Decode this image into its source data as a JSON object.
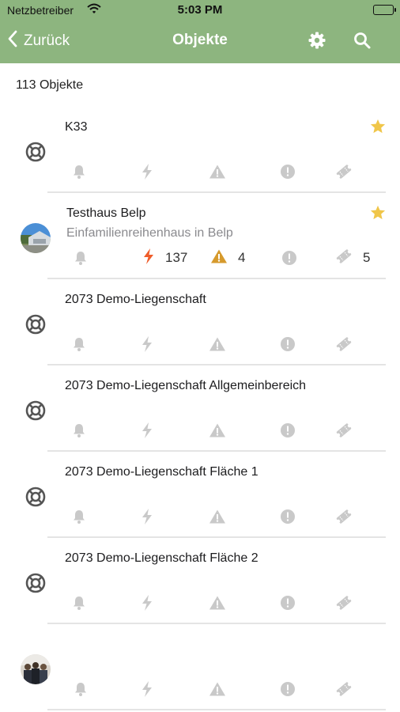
{
  "status_bar": {
    "carrier": "Netzbetreiber",
    "time": "5:03 PM"
  },
  "nav": {
    "back_label": "Zurück",
    "title": "Objekte"
  },
  "summary": {
    "count_text": "113 Objekte"
  },
  "colors": {
    "header_green": "#8db57f",
    "icon_gray": "#c9c9c9",
    "star_yellow": "#f0c64a",
    "bolt_orange": "#ef5d2a",
    "warning_amber": "#d69a2d"
  },
  "objects": [
    {
      "name": "K33",
      "subtitle": "",
      "leading": "lifebuoy-icon",
      "favorite": true,
      "stats": {
        "alarms": "",
        "faults": "",
        "warnings": "",
        "infos": "",
        "tickets": ""
      }
    },
    {
      "name": "Testhaus Belp",
      "subtitle": "Einfamilienreihenhaus in Belp",
      "leading": "house-photo-avatar",
      "favorite": true,
      "stats": {
        "alarms": "",
        "faults": "137",
        "warnings": "4",
        "infos": "",
        "tickets": "5"
      }
    },
    {
      "name": "2073 Demo-Liegenschaft",
      "subtitle": "",
      "leading": "lifebuoy-icon",
      "favorite": false,
      "stats": {
        "alarms": "",
        "faults": "",
        "warnings": "",
        "infos": "",
        "tickets": ""
      }
    },
    {
      "name": "2073 Demo-Liegenschaft Allgemeinbereich",
      "subtitle": "",
      "leading": "lifebuoy-icon",
      "favorite": false,
      "stats": {
        "alarms": "",
        "faults": "",
        "warnings": "",
        "infos": "",
        "tickets": ""
      }
    },
    {
      "name": "2073 Demo-Liegenschaft Fläche 1",
      "subtitle": "",
      "leading": "lifebuoy-icon",
      "favorite": false,
      "stats": {
        "alarms": "",
        "faults": "",
        "warnings": "",
        "infos": "",
        "tickets": ""
      }
    },
    {
      "name": "2073 Demo-Liegenschaft Fläche 2",
      "subtitle": "",
      "leading": "lifebuoy-icon",
      "favorite": false,
      "stats": {
        "alarms": "",
        "faults": "",
        "warnings": "",
        "infos": "",
        "tickets": ""
      }
    },
    {
      "name": "",
      "subtitle": "",
      "leading": "group-photo-avatar",
      "favorite": false,
      "stats": {
        "alarms": "",
        "faults": "",
        "warnings": "",
        "infos": "",
        "tickets": ""
      }
    }
  ]
}
